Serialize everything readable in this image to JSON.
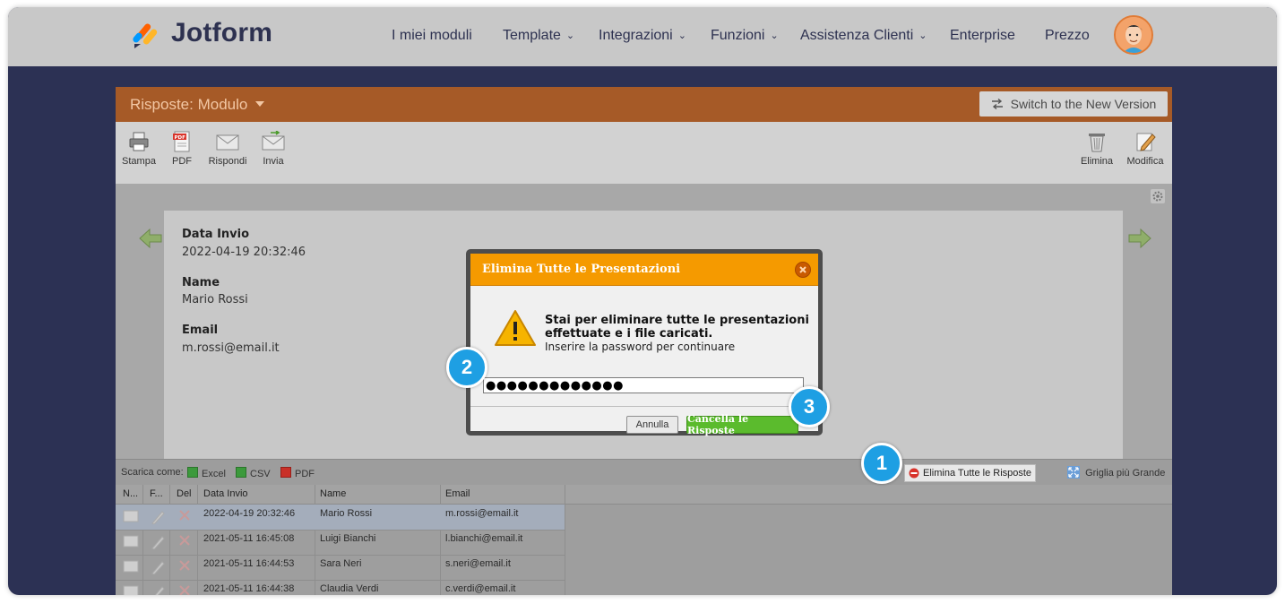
{
  "brand": {
    "name": "Jotform"
  },
  "nav": [
    {
      "label": "I miei moduli",
      "has_menu": false
    },
    {
      "label": "Template",
      "has_menu": true
    },
    {
      "label": "Integrazioni",
      "has_menu": true
    },
    {
      "label": "Funzioni",
      "has_menu": true
    },
    {
      "label": "Assistenza Clienti",
      "has_menu": true
    },
    {
      "label": "Enterprise",
      "has_menu": false
    },
    {
      "label": "Prezzo",
      "has_menu": false
    }
  ],
  "nav_chevron": "⌄",
  "panel": {
    "title": "Risposte: Modulo",
    "switch_label": "Switch to the New Version"
  },
  "toolbar": {
    "stampa": "Stampa",
    "pdf": "PDF",
    "rispondi": "Rispondi",
    "invia": "Invia",
    "elimina": "Elimina",
    "modifica": "Modifica"
  },
  "submission": {
    "fields": [
      {
        "label": "Data Invio",
        "value": "2022-04-19 20:32:46"
      },
      {
        "label": "Name",
        "value": "Mario Rossi"
      },
      {
        "label": "Email",
        "value": "m.rossi@email.it"
      }
    ]
  },
  "bottombar": {
    "download_label": "Scarica come:",
    "excel": "Excel",
    "csv": "CSV",
    "pdf": "PDF",
    "delete_all": "Elimina Tutte le Risposte",
    "bigger_grid": "Griglia più Grande"
  },
  "table": {
    "headers": [
      "N...",
      "F...",
      "Del",
      "Data Invio",
      "Name",
      "Email"
    ],
    "rows": [
      {
        "date": "2022-04-19 20:32:46",
        "name": "Mario Rossi",
        "email": "m.rossi@email.it"
      },
      {
        "date": "2021-05-11 16:45:08",
        "name": "Luigi Bianchi",
        "email": "l.bianchi@email.it"
      },
      {
        "date": "2021-05-11 16:44:53",
        "name": "Sara Neri",
        "email": "s.neri@email.it"
      },
      {
        "date": "2021-05-11 16:44:38",
        "name": "Claudia Verdi",
        "email": "c.verdi@email.it"
      }
    ]
  },
  "modal": {
    "title": "Elimina Tutte le Presentazioni",
    "message": "Stai per eliminare tutte le presentazioni effettuate e i file caricati.",
    "hint": "Inserire la password per continuare",
    "password_value": "●●●●●●●●●●●●●",
    "cancel_label": "Annulla",
    "confirm_label": "Cancella le Risposte"
  },
  "steps": [
    "1",
    "2",
    "3"
  ],
  "colors": {
    "brand_dark": "#2d3150",
    "panel_header": "#a65a27",
    "modal_header": "#f59a00",
    "confirm_green": "#5bbb2d",
    "step_blue": "#1e9fe3"
  }
}
